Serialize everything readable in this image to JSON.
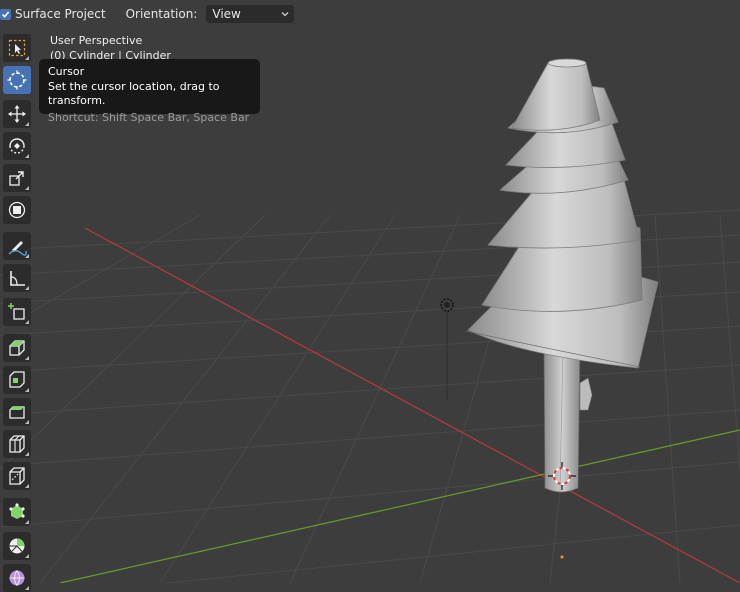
{
  "header": {
    "surface_project_label": "Surface Project",
    "surface_project_checked": true,
    "orientation_label": "Orientation:",
    "orientation_value": "View"
  },
  "viewport": {
    "perspective_label": "User Perspective",
    "object_label": "(0) Cylinder | Cylinder"
  },
  "tooltip": {
    "title": "Cursor",
    "description": "Set the cursor location, drag to transform.",
    "shortcut": "Shortcut: Shift Space Bar, Space Bar"
  },
  "toolbar": {
    "tools": [
      {
        "name": "select-box",
        "icon": "select-box-icon"
      },
      {
        "name": "cursor",
        "icon": "cursor-icon",
        "active": true
      },
      {
        "name": "move",
        "icon": "move-icon"
      },
      {
        "name": "rotate",
        "icon": "rotate-icon"
      },
      {
        "name": "scale",
        "icon": "scale-icon"
      },
      {
        "name": "transform",
        "icon": "transform-icon"
      },
      {
        "name": "annotate",
        "icon": "annotate-icon"
      },
      {
        "name": "measure",
        "icon": "measure-icon"
      },
      {
        "name": "add-cube",
        "icon": "add-cube-icon"
      },
      {
        "name": "extrude-region",
        "icon": "extrude-region-icon"
      },
      {
        "name": "inset-faces",
        "icon": "inset-faces-icon"
      },
      {
        "name": "bevel",
        "icon": "bevel-icon"
      },
      {
        "name": "loop-cut",
        "icon": "loop-cut-icon"
      },
      {
        "name": "knife",
        "icon": "knife-icon"
      },
      {
        "name": "poly-build",
        "icon": "poly-build-icon"
      },
      {
        "name": "spin",
        "icon": "spin-icon"
      },
      {
        "name": "smooth",
        "icon": "smooth-icon"
      }
    ]
  },
  "colors": {
    "accent": "#4772b3",
    "viewport_bg": "#3d3d3d",
    "x_axis": "#b83b3b",
    "y_axis": "#6b9a2a"
  }
}
